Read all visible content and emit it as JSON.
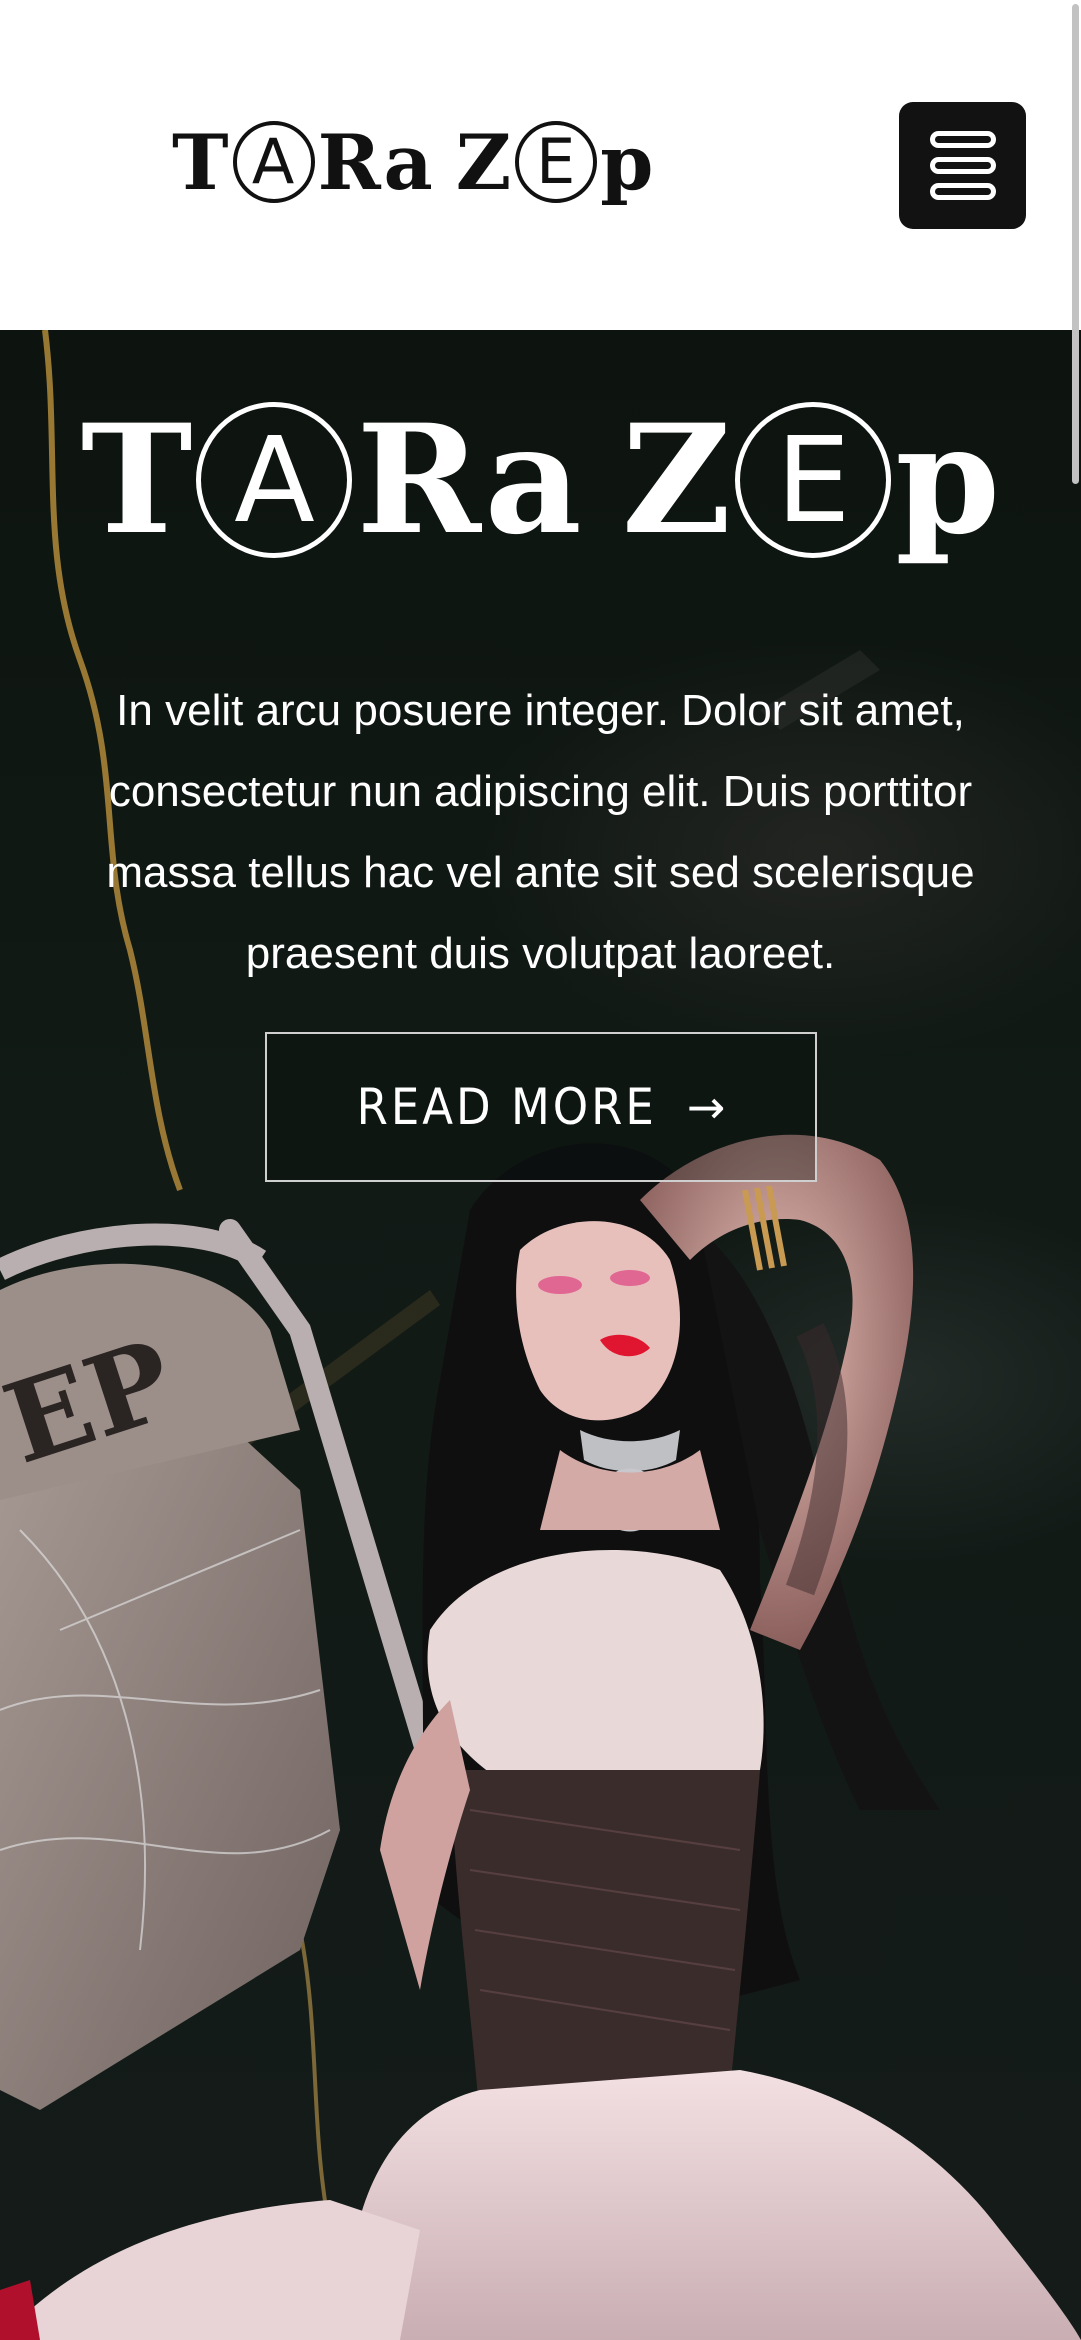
{
  "header": {
    "logo": {
      "parts": [
        "T",
        "A",
        "Ra",
        "Z",
        "E",
        "p"
      ]
    },
    "menu_icon": "hamburger-menu-icon"
  },
  "hero": {
    "title": {
      "parts": [
        "T",
        "A",
        "Ra",
        "Z",
        "E",
        "p"
      ]
    },
    "description": "In velit arcu posuere integer. Dolor sit amet, consectetur nun adipiscing elit. Duis porttitor massa tellus hac vel ante sit sed scelerisque praesent duis volutpat laoreet.",
    "button": {
      "label": "READ MORE",
      "icon": "arrow-right-icon",
      "arrow_glyph": "→"
    },
    "image": {
      "chair_text": "EP"
    }
  },
  "colors": {
    "header_bg": "#ffffff",
    "logo_text": "#111111",
    "menu_button_bg": "#121212",
    "hero_bg": "#111a15",
    "hero_text": "#ffffff",
    "button_border": "#cfcfcf"
  }
}
